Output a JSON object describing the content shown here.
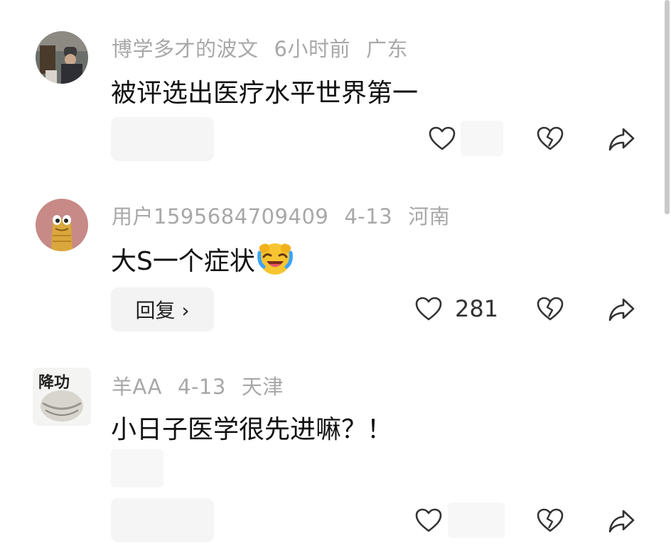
{
  "comments": [
    {
      "username": "博学多才的波文",
      "time": "6小时前",
      "location": "广东",
      "text": "被评选出医疗水平世界第一",
      "reply_label": "",
      "like_count": ""
    },
    {
      "username": "用户1595684709409",
      "time": "4-13",
      "location": "河南",
      "text": "大S一个症状",
      "emoji": "laughing-tears-emoji",
      "reply_label": "回复 ›",
      "like_count": "281"
    },
    {
      "username": "羊AA",
      "time": "4-13",
      "location": "天津",
      "text": "小日子医学很先进嘛？！",
      "reply_label": "",
      "like_count": ""
    }
  ],
  "icons": {
    "like": "heart-icon",
    "dislike": "broken-heart-icon",
    "share": "share-arrow-icon"
  },
  "colors": {
    "meta_text": "#a8a8a8",
    "body_text": "#111111",
    "icon_stroke": "#333333"
  }
}
